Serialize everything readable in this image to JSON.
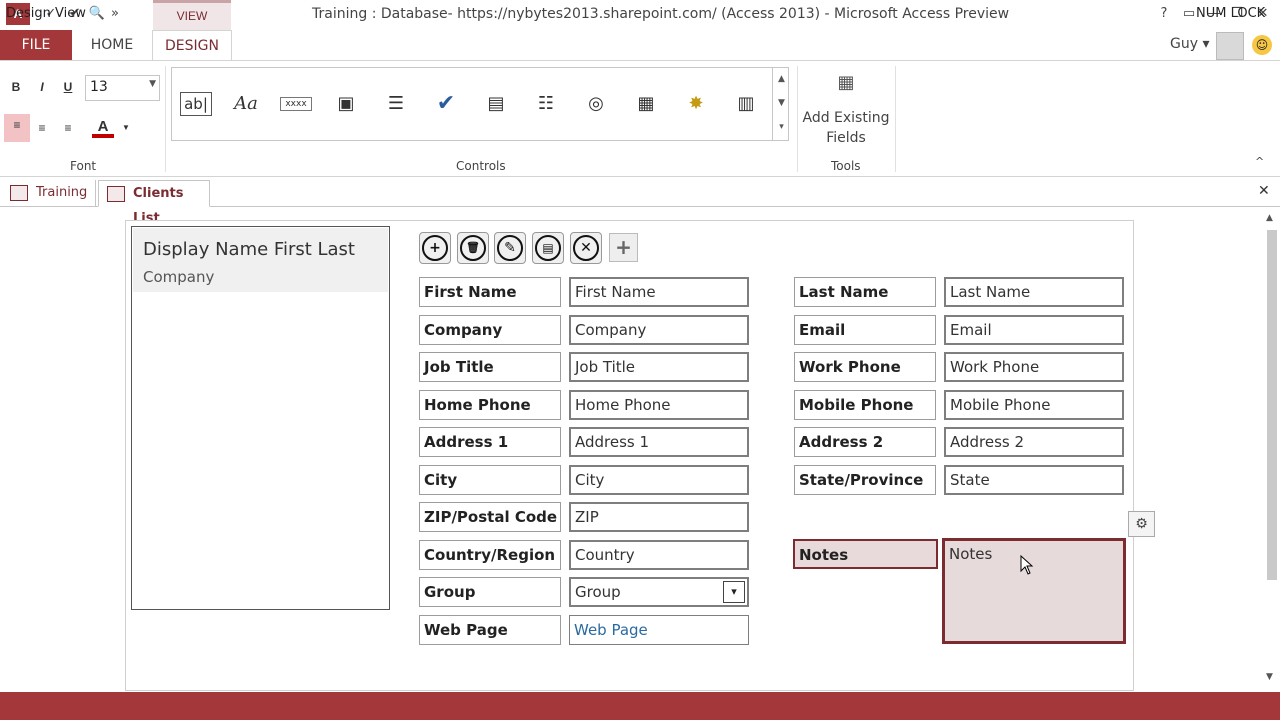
{
  "titlebar": {
    "app_icon": "A",
    "title": "Training : Database- https://nybytes2013.sharepoint.com/ (Access 2013) - Microsoft Access Preview",
    "context_tab": "VIEW",
    "qat_icons": [
      "spelling-icon",
      "check-icon",
      "print-preview-icon",
      "customize-qat-icon"
    ],
    "controls": {
      "help": "?",
      "restore_ribbon": "▭",
      "minimize": "—",
      "maximize": "❐",
      "close": "✕"
    }
  },
  "tabs": {
    "file": "FILE",
    "home": "HOME",
    "design": "DESIGN"
  },
  "user": {
    "name": "Guy",
    "menu_arrow": "▾"
  },
  "ribbon": {
    "font_group": {
      "label": "Font",
      "bold": "B",
      "italic": "I",
      "underline": "U",
      "font_size": "13",
      "font_color_letter": "A"
    },
    "controls_group": {
      "label": "Controls",
      "items": [
        {
          "name": "textbox-control-icon",
          "glyph": "ab|"
        },
        {
          "name": "label-control-icon",
          "glyph": "Aa"
        },
        {
          "name": "multiline-textbox-icon",
          "glyph": "xxxx"
        },
        {
          "name": "image-control-icon",
          "glyph": "▣"
        },
        {
          "name": "combobox-control-icon",
          "glyph": "☰"
        },
        {
          "name": "checkbox-control-icon",
          "glyph": "✔"
        },
        {
          "name": "related-items-icon",
          "glyph": "▤"
        },
        {
          "name": "autocomplete-icon",
          "glyph": "☷"
        },
        {
          "name": "hyperlink-control-icon",
          "glyph": "◎"
        },
        {
          "name": "subview-control-icon",
          "glyph": "▦"
        },
        {
          "name": "web-browser-control-icon",
          "glyph": "✸"
        },
        {
          "name": "button-control-icon",
          "glyph": "▥"
        }
      ]
    },
    "tools_group": {
      "label": "Tools",
      "add_existing_fields": "Add Existing Fields"
    },
    "collapse": "^"
  },
  "doc_tabs": [
    {
      "label": "Training"
    },
    {
      "label": "Clients List"
    }
  ],
  "list_control": {
    "primary": "Display Name First Last",
    "secondary": "Company"
  },
  "action_bar": {
    "add": "+",
    "delete": "🗑",
    "edit": "✎",
    "save": "▤",
    "cancel": "✕",
    "add_action": "+"
  },
  "form": {
    "left": [
      {
        "label": "First Name",
        "value": "First Name"
      },
      {
        "label": "Company",
        "value": "Company"
      },
      {
        "label": "Job Title",
        "value": "Job Title"
      },
      {
        "label": "Home Phone",
        "value": "Home Phone"
      },
      {
        "label": "Address 1",
        "value": "Address 1"
      },
      {
        "label": "City",
        "value": "City"
      },
      {
        "label": "ZIP/Postal Code",
        "value": "ZIP"
      },
      {
        "label": "Country/Region",
        "value": "Country"
      },
      {
        "label": "Group",
        "value": "Group"
      },
      {
        "label": "Web Page",
        "value": "Web Page"
      }
    ],
    "right": [
      {
        "label": "Last Name",
        "value": "Last Name"
      },
      {
        "label": "Email",
        "value": "Email"
      },
      {
        "label": "Work Phone",
        "value": "Work Phone"
      },
      {
        "label": "Mobile Phone",
        "value": "Mobile Phone"
      },
      {
        "label": "Address 2",
        "value": "Address 2"
      },
      {
        "label": "State/Province",
        "value": "State"
      }
    ],
    "notes": {
      "label": "Notes",
      "value": "Notes"
    },
    "dropdown_arrow": "▾"
  },
  "colors": {
    "accent": "#a4373a",
    "selection": "#7a2c31"
  },
  "statusbar": {
    "left": "Design View",
    "right": "NUM LOCK"
  }
}
